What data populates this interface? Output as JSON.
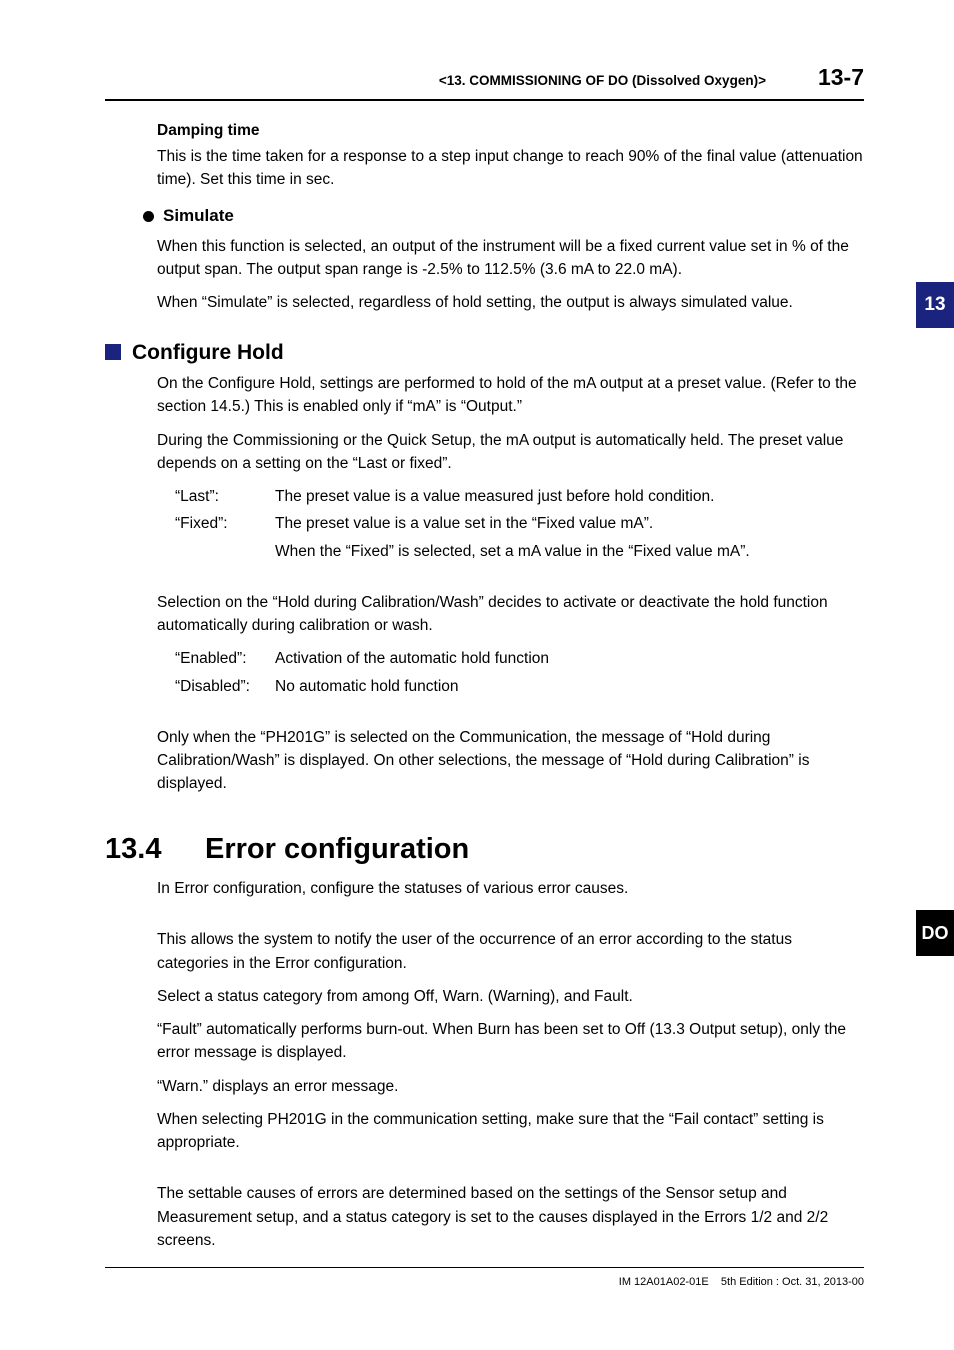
{
  "header": {
    "chapter": "<13.  COMMISSIONING OF DO (Dissolved Oxygen)>",
    "page": "13-7"
  },
  "tabs": {
    "tab1": "13",
    "tab2": "DO"
  },
  "s1": {
    "h": "Damping time",
    "p": "This is the time taken for a response to a step input change to reach 90% of the final value (attenuation time). Set this time in sec."
  },
  "s2": {
    "h": "Simulate",
    "p1": "When this function is selected, an output of the instrument will be a fixed current value set in % of the output span. The output span range is -2.5% to 112.5% (3.6 mA to 22.0 mA).",
    "p2": "When “Simulate” is selected, regardless of hold setting, the output is always simulated value."
  },
  "s3": {
    "h": "Configure Hold",
    "p1": "On the Configure Hold, settings are performed to hold of the mA output at a preset value. (Refer to the section 14.5.) This is enabled only if “mA” is “Output.”",
    "p2": "During the Commissioning or the Quick Setup, the mA output is automatically held. The preset value depends on a setting on the “Last or fixed”.",
    "def1": {
      "t1": "“Last”:",
      "d1": "The preset value is a value measured just before hold condition.",
      "t2": "“Fixed”:",
      "d2": "The preset value is a value set in the “Fixed value mA”.",
      "d2b": "When the “Fixed” is selected, set a mA value in the “Fixed value mA”."
    },
    "p3": "Selection on the “Hold during Calibration/Wash” decides to activate or deactivate the hold function automatically during calibration or wash.",
    "def2": {
      "t1": "“Enabled”:",
      "d1": "Activation of the automatic hold function",
      "t2": "“Disabled”:",
      "d2": "No automatic hold function"
    },
    "p4": "Only when the “PH201G” is selected on the Communication, the message of “Hold during Calibration/Wash” is displayed. On other selections, the message of “Hold during Calibration” is displayed."
  },
  "s4": {
    "num": "13.4",
    "h": "Error configuration",
    "p1": "In Error configuration, configure the statuses of various error causes.",
    "p2": "This allows the system to notify the user of the occurrence of an error according to the status categories in the Error configuration.",
    "p3": "Select a status category from among Off, Warn. (Warning), and Fault.",
    "p4": "“Fault” automatically performs burn-out. When Burn has been set to Off (13.3 Output setup), only the error message is displayed.",
    "p5": "“Warn.” displays an error message.",
    "p6": "When selecting PH201G in the communication setting, make sure that the “Fail contact” setting is appropriate.",
    "p7": "The settable causes of errors are determined based on the settings of the Sensor setup and Measurement setup, and a status category is set to the causes displayed in the Errors 1/2 and 2/2 screens."
  },
  "footer": {
    "text": "IM 12A01A02-01E    5th Edition : Oct. 31, 2013-00"
  }
}
